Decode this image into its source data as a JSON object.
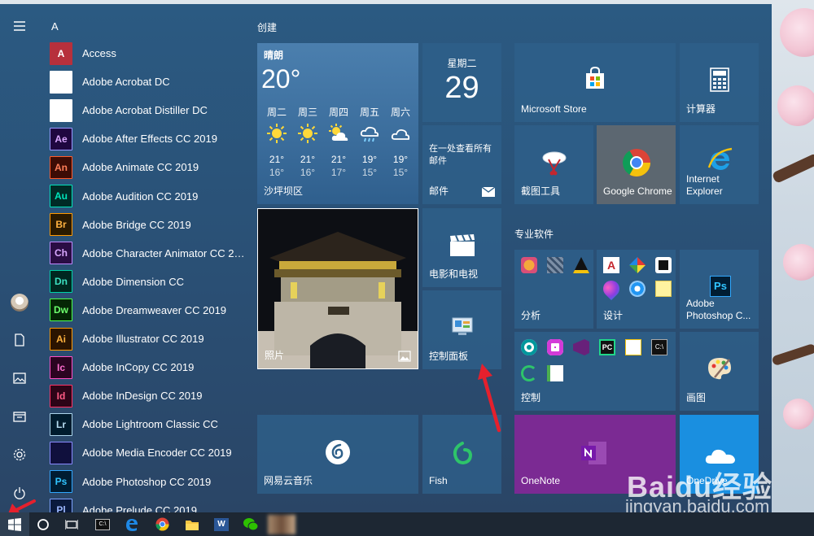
{
  "wallpaper": {
    "brand": "Baidu经验",
    "site": "jingyan.baidu.com"
  },
  "start_menu": {
    "section_letter": "A",
    "apps": [
      {
        "label": "Access",
        "abbr": "A",
        "color": "#b7303c",
        "fill": "#b7303c",
        "text_color": "#fff"
      },
      {
        "label": "Adobe Acrobat DC",
        "abbr": "",
        "color": "#ffffff",
        "fill": "#ffffff",
        "text_color": "#c4262e"
      },
      {
        "label": "Adobe Acrobat Distiller DC",
        "abbr": "",
        "color": "#ffffff",
        "fill": "#ffffff",
        "text_color": "#c4262e"
      },
      {
        "label": "Adobe After Effects CC 2019",
        "abbr": "Ae",
        "color": "#9999ff",
        "fill": "#1f0740",
        "text_color": "#d9a7ff"
      },
      {
        "label": "Adobe Animate CC 2019",
        "abbr": "An",
        "color": "#ff5b2b",
        "fill": "#3d0c05",
        "text_color": "#ff7f5a"
      },
      {
        "label": "Adobe Audition CC 2019",
        "abbr": "Au",
        "color": "#00e4bb",
        "fill": "#002b26",
        "text_color": "#00e4bb"
      },
      {
        "label": "Adobe Bridge CC 2019",
        "abbr": "Br",
        "color": "#ff9a00",
        "fill": "#2a1a00",
        "text_color": "#ffb240"
      },
      {
        "label": "Adobe Character Animator CC 20...",
        "abbr": "Ch",
        "color": "#c08bff",
        "fill": "#2a0d44",
        "text_color": "#d9a7ff"
      },
      {
        "label": "Adobe Dimension CC",
        "abbr": "Dn",
        "color": "#00d3a8",
        "fill": "#002820",
        "text_color": "#3de0c1"
      },
      {
        "label": "Adobe Dreamweaver CC 2019",
        "abbr": "Dw",
        "color": "#4cff4c",
        "fill": "#052605",
        "text_color": "#6eff6e"
      },
      {
        "label": "Adobe Illustrator CC 2019",
        "abbr": "Ai",
        "color": "#ff9a00",
        "fill": "#2b1400",
        "text_color": "#ffb13d"
      },
      {
        "label": "Adobe InCopy CC 2019",
        "abbr": "Ic",
        "color": "#ff4fc4",
        "fill": "#2b0421",
        "text_color": "#ff6ed0"
      },
      {
        "label": "Adobe InDesign CC 2019",
        "abbr": "Id",
        "color": "#ff3366",
        "fill": "#2d0417",
        "text_color": "#ff5c85"
      },
      {
        "label": "Adobe Lightroom Classic CC",
        "abbr": "Lr",
        "color": "#add5ec",
        "fill": "#001c2e",
        "text_color": "#b6dcf0"
      },
      {
        "label": "Adobe Media Encoder CC 2019",
        "abbr": "",
        "color": "#8a8aff",
        "fill": "#10103d",
        "text_color": "#b3b3ff"
      },
      {
        "label": "Adobe Photoshop CC 2019",
        "abbr": "Ps",
        "color": "#31a8ff",
        "fill": "#001d33",
        "text_color": "#31c5ff"
      },
      {
        "label": "Adobe Prelude CC 2019",
        "abbr": "Pl",
        "color": "#7fa3ff",
        "fill": "#0a1a3d",
        "text_color": "#9db8ff"
      }
    ],
    "groups": {
      "create": "创建",
      "pro": "专业软件"
    },
    "weather": {
      "condition": "晴朗",
      "temp": "20°",
      "location": "沙坪坝区",
      "days": [
        {
          "name": "周二",
          "hi": "21°",
          "lo": "16°",
          "icon": "sun-icon"
        },
        {
          "name": "周三",
          "hi": "21°",
          "lo": "16°",
          "icon": "sun-icon"
        },
        {
          "name": "周四",
          "hi": "21°",
          "lo": "17°",
          "icon": "partly-cloudy-icon"
        },
        {
          "name": "周五",
          "hi": "19°",
          "lo": "15°",
          "icon": "rain-icon"
        },
        {
          "name": "周六",
          "hi": "19°",
          "lo": "15°",
          "icon": "cloud-icon"
        }
      ]
    },
    "calendar": {
      "weekday": "星期二",
      "day": "29"
    },
    "mail": {
      "blurb": "在一处查看所有邮件",
      "label": "邮件"
    },
    "tiles": {
      "photos": "照片",
      "movies": "电影和电视",
      "control_panel": "控制面板",
      "netease": "网易云音乐",
      "fish": "Fish",
      "store": "Microsoft Store",
      "calculator": "计算器",
      "snipping": "截图工具",
      "chrome": "Google Chrome",
      "ie": "Internet Explorer",
      "analysis": "分析",
      "design": "设计",
      "photoshop": "Adobe Photoshop C...",
      "control": "控制",
      "paint": "画图",
      "onenote": "OneNote",
      "onedrive": "OneDrive"
    },
    "mini_icon_text": {
      "pc": "PC",
      "acrobat": "A",
      "cmd": "C:\\"
    }
  },
  "taskbar": {
    "cmd_text": "C:\\",
    "word_text": "W",
    "items": [
      "start-icon",
      "cortana-icon",
      "task-view-icon",
      "cmd-icon",
      "edge-icon",
      "chrome-icon",
      "explorer-icon",
      "word-icon",
      "wechat-icon",
      "user-app-icon"
    ]
  }
}
